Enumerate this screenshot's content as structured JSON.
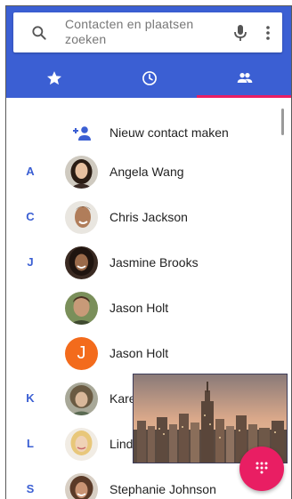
{
  "search": {
    "placeholder": "Contacten en plaatsen zoeken",
    "icon": "search-icon",
    "mic_icon": "mic-icon",
    "menu_icon": "more-vert-icon"
  },
  "tabs": [
    {
      "name": "favorites",
      "icon": "star-icon",
      "selected": false
    },
    {
      "name": "recent",
      "icon": "clock-icon",
      "selected": false
    },
    {
      "name": "contacts",
      "icon": "people-icon",
      "selected": true
    }
  ],
  "colors": {
    "header": "#3b5fd3",
    "accent": "#e91e63",
    "letter": "#3b5fd3",
    "avatar_orange": "#f36b1c"
  },
  "create_contact": {
    "label": "Nieuw contact maken",
    "icon": "add-person-icon"
  },
  "contacts": [
    {
      "letter": "A",
      "name": "Angela Wang"
    },
    {
      "letter": "C",
      "name": "Chris Jackson"
    },
    {
      "letter": "J",
      "name": "Jasmine Brooks"
    },
    {
      "letter": "",
      "name": "Jason Holt"
    },
    {
      "letter": "",
      "name": "Jason Holt",
      "initial": "J"
    },
    {
      "letter": "K",
      "name": "Kare"
    },
    {
      "letter": "L",
      "name": "Lind"
    },
    {
      "letter": "S",
      "name": "Stephanie Johnson"
    }
  ],
  "fab": {
    "icon": "dialpad-icon"
  },
  "pip": {
    "content": "city-skyline-video"
  }
}
